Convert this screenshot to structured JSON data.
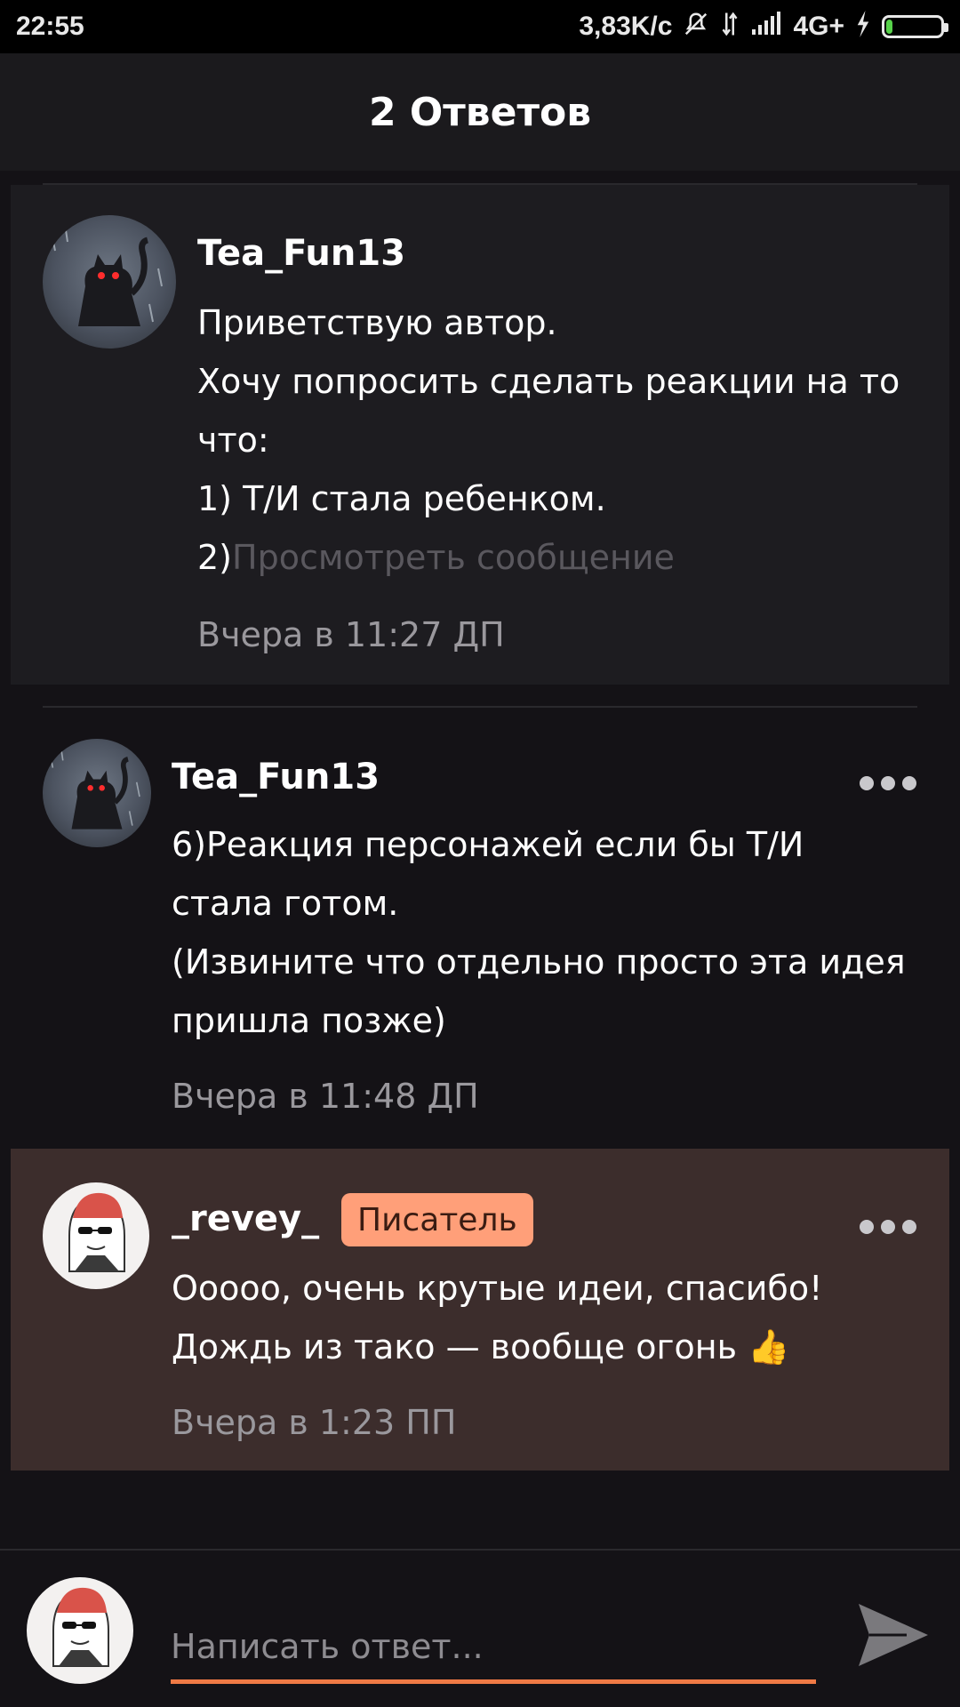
{
  "status_bar": {
    "time": "22:55",
    "speed": "3,83K/c",
    "network": "4G+",
    "battery_level": 0.05,
    "icons": [
      "bell-muted-icon",
      "data-arrows-icon",
      "signal-icon",
      "charging-icon",
      "battery-icon"
    ]
  },
  "header": {
    "title": "2 Ответов"
  },
  "parent_comment": {
    "username": "Tea_Fun13",
    "text": "Приветствую автор.\nХочу попросить сделать реакции на то что:\n1) Т/И стала ребенком.\n2)",
    "view_message": "Просмотреть сообщение",
    "time": "Вчера в 11:27 ДП"
  },
  "replies": [
    {
      "username": "Tea_Fun13",
      "text": "6)Реакция персонажей если бы Т/И стала готом.\n(Извините что отдельно просто эта идея пришла позже)",
      "time": "Вчера в 11:48 ДП"
    },
    {
      "username": "_revey_",
      "badge": "Писатель",
      "text": "Ооооо, очень крутые идеи, спасибо!\nДождь из тако — вообще огонь 👍",
      "time": "Вчера в 1:23 ПП"
    }
  ],
  "reply_box": {
    "placeholder": "Написать ответ..."
  },
  "colors": {
    "accent": "#f07a45",
    "badge": "#ff9f79",
    "highlight_bg": "#3c2d2c",
    "background": "#141216"
  }
}
